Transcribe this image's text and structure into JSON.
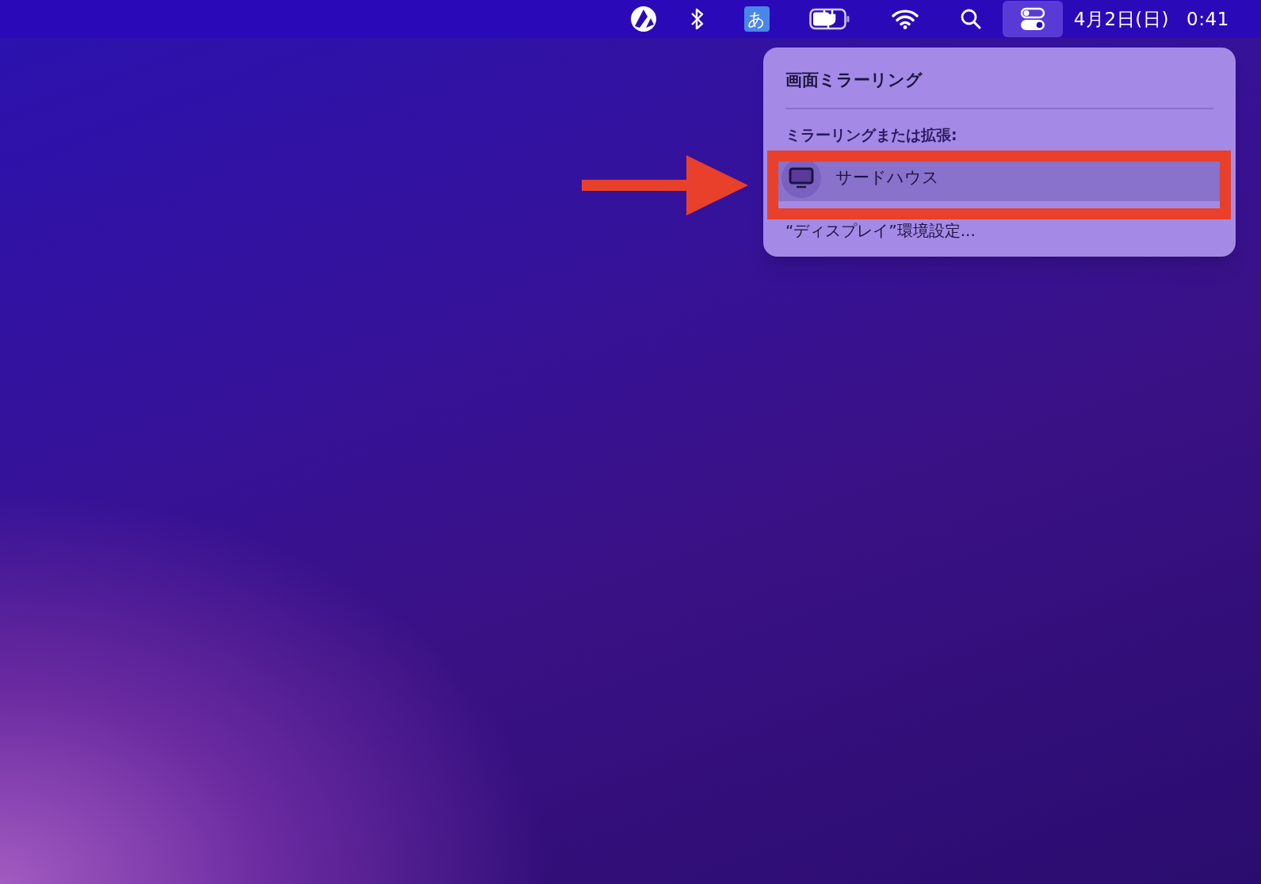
{
  "menu_bar": {
    "items": [
      {
        "kind": "app",
        "selected": false
      },
      {
        "kind": "bluetooth",
        "selected": false
      },
      {
        "kind": "input",
        "label": "あ",
        "selected": false
      },
      {
        "kind": "battery",
        "selected": false
      },
      {
        "kind": "wifi",
        "selected": false
      },
      {
        "kind": "search",
        "selected": false
      },
      {
        "kind": "control-center",
        "selected": true
      }
    ],
    "date": "4月2日(日)",
    "time": "0:41"
  },
  "popup": {
    "title": "画面ミラーリング",
    "section_label": "ミラーリングまたは拡張:",
    "devices": [
      {
        "name": "サードハウス",
        "selected": true
      }
    ],
    "footer": "“ディスプレイ”環境設定..."
  },
  "annotation": {
    "arrow": true,
    "frame": true
  }
}
